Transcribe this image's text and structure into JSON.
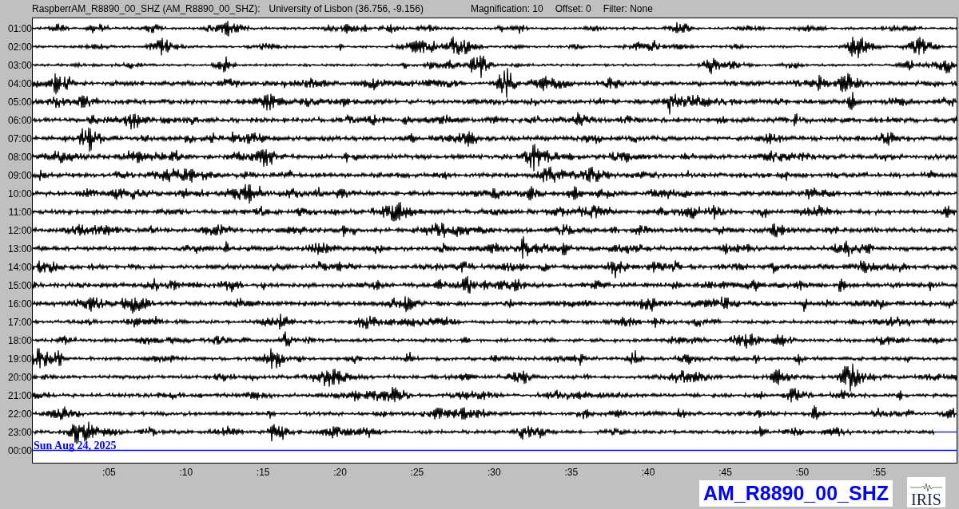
{
  "header": {
    "station": "RaspberrAM_R8890_00_SHZ (AM_R8890_00_SHZ):",
    "location": "University of Lisbon (36.756, -9.156)",
    "magnification": "Magnification: 10",
    "offset": "Offset: 0",
    "filter": "Filter: None"
  },
  "helicorder": {
    "rows": [
      {
        "time": "01:00",
        "level": 1
      },
      {
        "time": "02:00",
        "level": 1
      },
      {
        "time": "03:00",
        "level": 1
      },
      {
        "time": "04:00",
        "level": 1
      },
      {
        "time": "05:00",
        "level": 1
      },
      {
        "time": "06:00",
        "level": 1
      },
      {
        "time": "07:00",
        "level": 1
      },
      {
        "time": "08:00",
        "level": 1
      },
      {
        "time": "09:00",
        "level": 1
      },
      {
        "time": "10:00",
        "level": 1
      },
      {
        "time": "11:00",
        "level": 1
      },
      {
        "time": "12:00",
        "level": 1
      },
      {
        "time": "13:00",
        "level": 1
      },
      {
        "time": "14:00",
        "level": 1
      },
      {
        "time": "15:00",
        "level": 1
      },
      {
        "time": "16:00",
        "level": 1
      },
      {
        "time": "17:00",
        "level": 1
      },
      {
        "time": "18:00",
        "level": 1
      },
      {
        "time": "19:00",
        "level": 1
      },
      {
        "time": "20:00",
        "level": 1
      },
      {
        "time": "21:00",
        "level": 1
      },
      {
        "time": "22:00",
        "level": 1
      },
      {
        "time": "23:00",
        "level": 0.975
      },
      {
        "time": "00:00"
      }
    ],
    "date": "Sun Aug 24, 2025",
    "x_ticks": [
      ":05",
      ":10",
      ":15",
      ":20",
      ":25",
      ":30",
      ":35",
      ":40",
      ":45",
      ":50",
      ":55"
    ]
  },
  "station_label": "AM_R8890_00_SHZ",
  "logo": "IRIS"
}
